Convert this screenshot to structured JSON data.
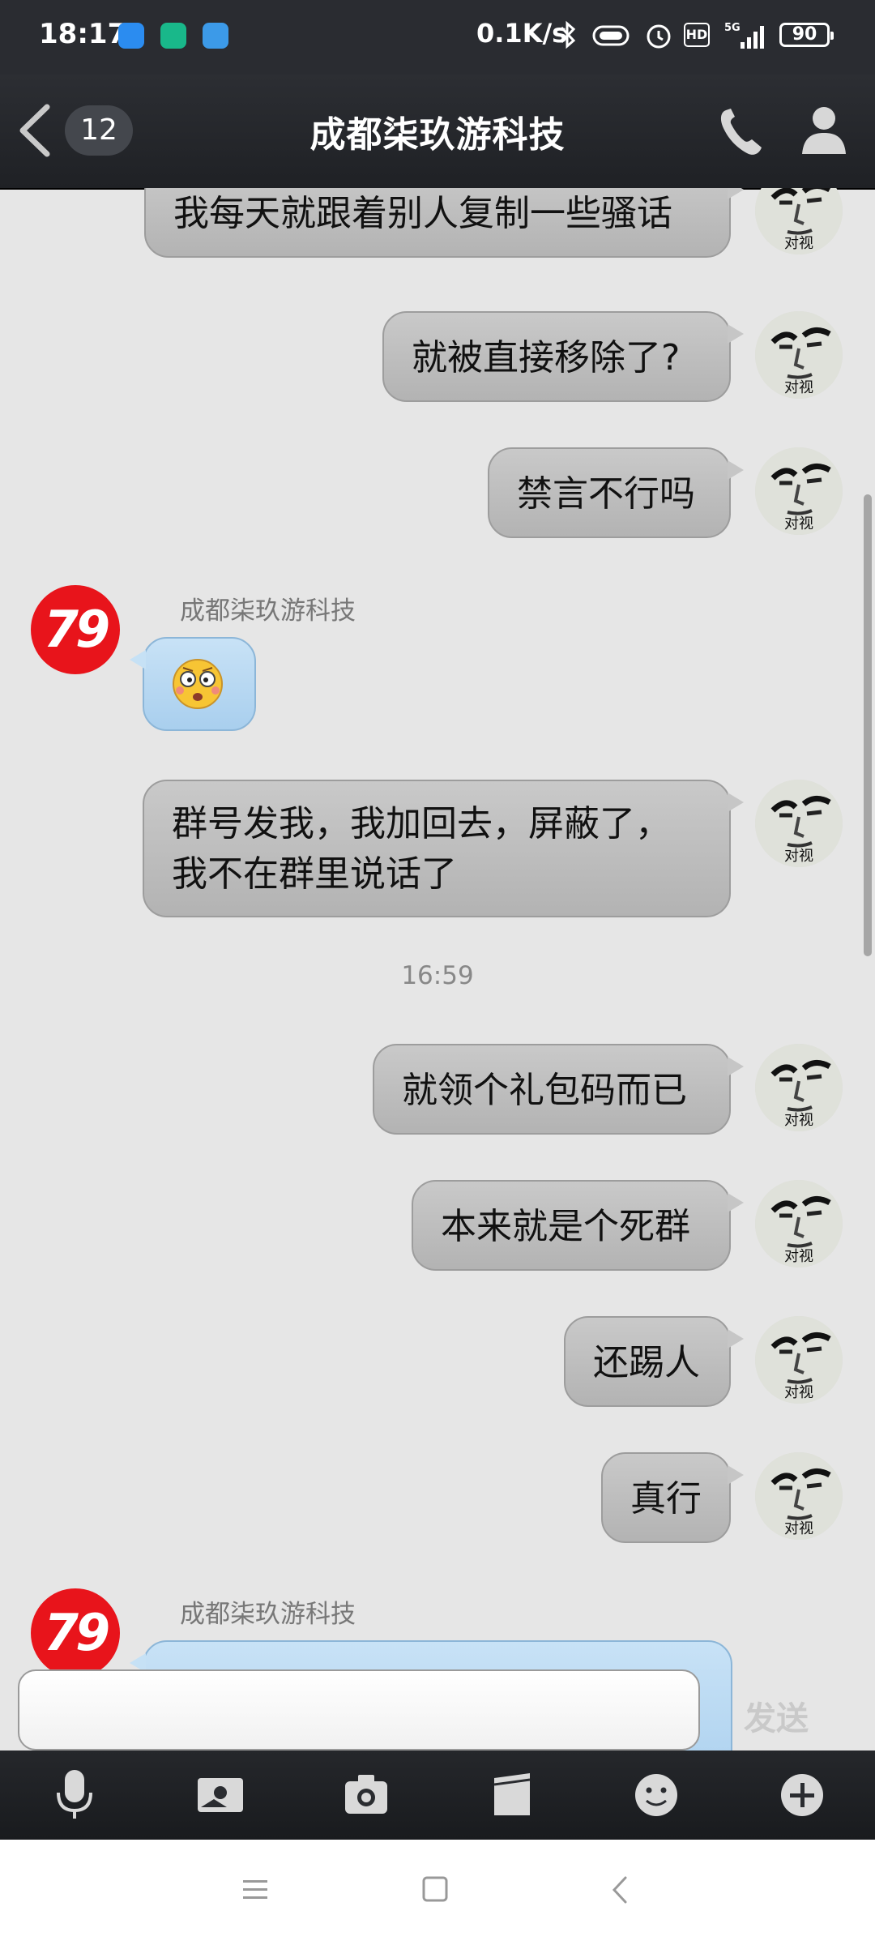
{
  "status_bar": {
    "time": "18:17",
    "net_speed": "0.1K/s",
    "signal_label": "5G",
    "hd_label": "HD",
    "battery": "90"
  },
  "header": {
    "unread_count": "12",
    "title": "成都柒玖游科技"
  },
  "messages": {
    "m1": "我每天就跟着别人复制一些骚话",
    "m2": "就被直接移除了?",
    "m3": "禁言不行吗",
    "m4_sender": "成都柒玖游科技",
    "m4_emoji": "flustered-emoji",
    "m5_line1": "群号发我，我加回去，屏蔽了，",
    "m5_line2": "我不在群里说话了",
    "timestamp": "16:59",
    "m6": "就领个礼包码而已",
    "m7": "本来就是个死群",
    "m8": "还踢人",
    "m9": "真行",
    "m10_sender": "成都柒玖游科技"
  },
  "self_avatar_label": "对视",
  "contact_avatar_label": "79",
  "input": {
    "placeholder": "",
    "value": "",
    "send_label": "发送"
  },
  "colors": {
    "contact_avatar": "#e8141b",
    "outgoing_bubble": "#bdbdbd",
    "incoming_bubble": "#b5d7f2",
    "header_bg": "#2a2c31"
  }
}
